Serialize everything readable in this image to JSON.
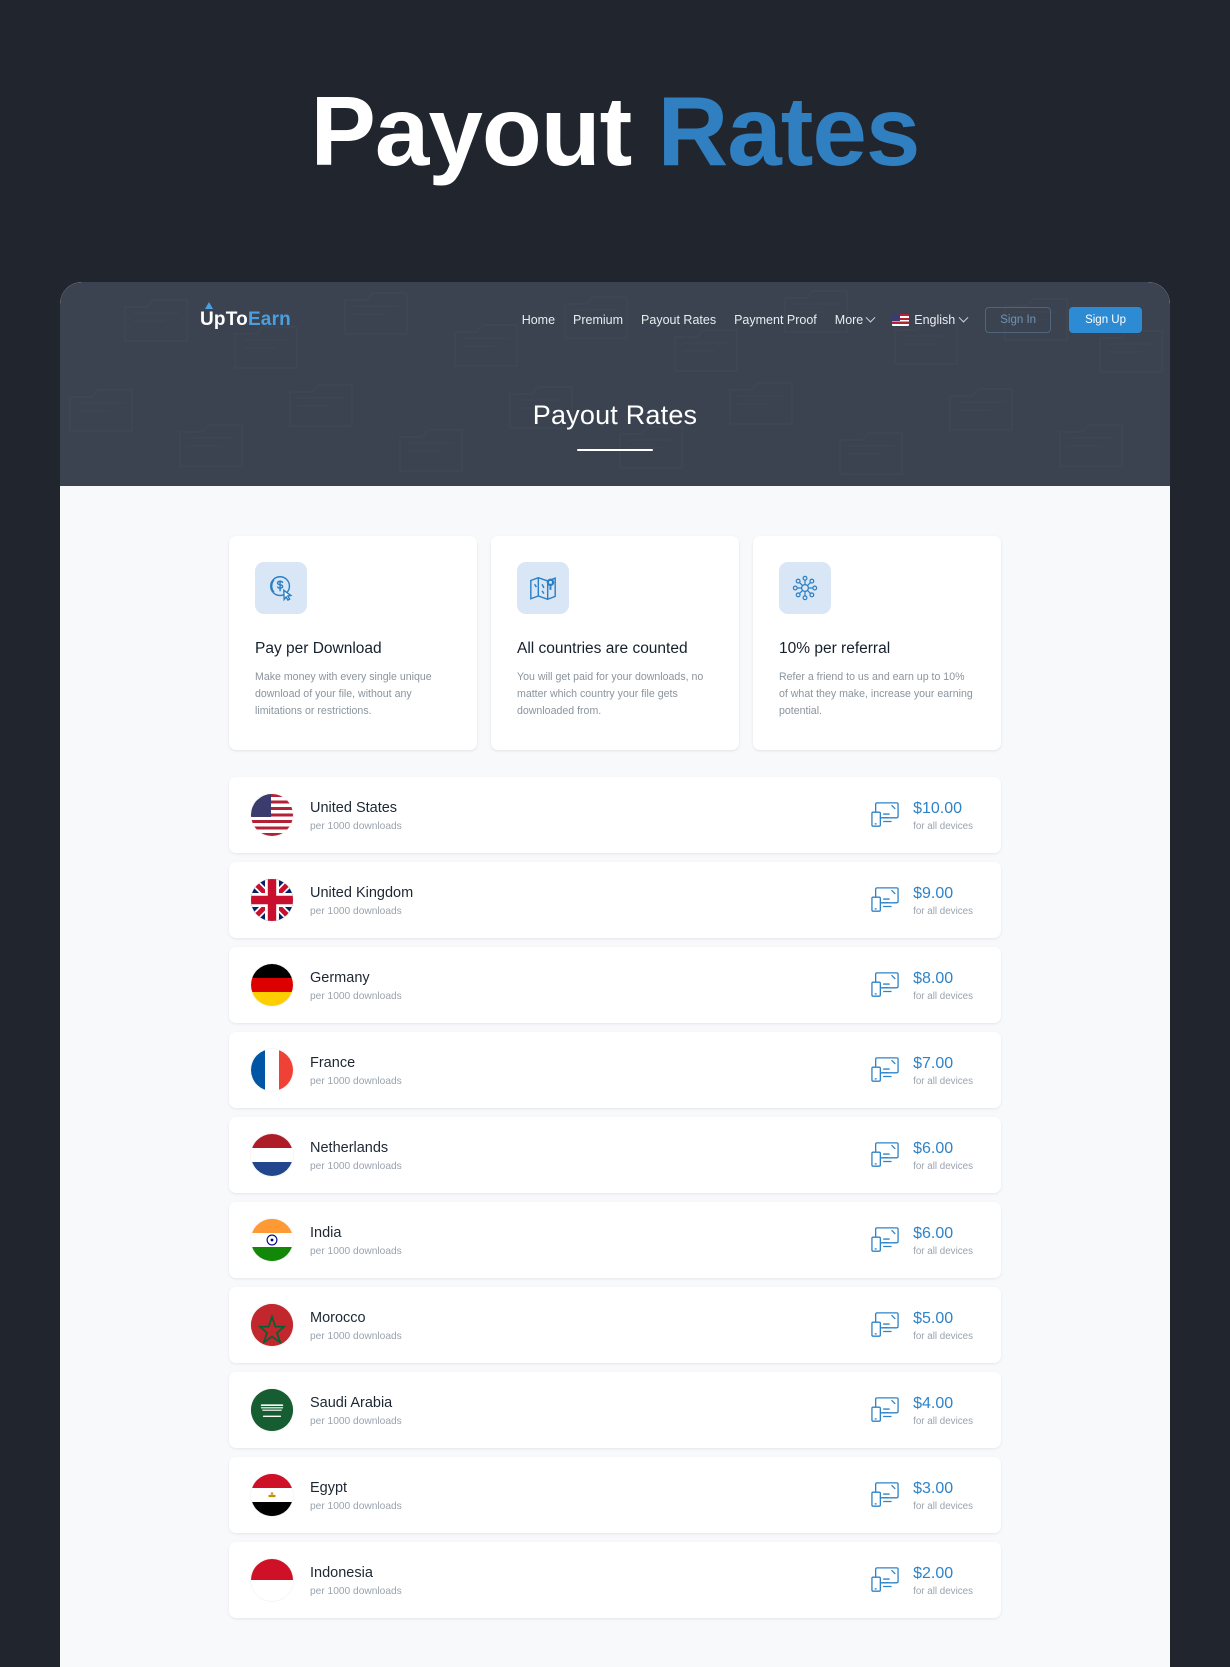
{
  "hero": {
    "word1": "Payout",
    "word2": "Rates"
  },
  "navbar": {
    "brand_up": "UpTo",
    "brand_earn": "Earn",
    "links": [
      {
        "label": "Home",
        "name": "nav-home"
      },
      {
        "label": "Premium",
        "name": "nav-premium"
      },
      {
        "label": "Payout Rates",
        "name": "nav-payout-rates"
      },
      {
        "label": "Payment Proof",
        "name": "nav-payment-proof"
      }
    ],
    "more_label": "More",
    "language": "English",
    "language_flag": "us-flag-icon",
    "sign_in": "Sign In",
    "sign_up": "Sign Up",
    "accent": "#2d8bd4"
  },
  "header": {
    "page_title": "Payout Rates"
  },
  "features": [
    {
      "icon": "coin-dollar-cursor-icon",
      "title": "Pay per Download",
      "desc": "Make money with every single unique download of your file, without any limitations or restrictions."
    },
    {
      "icon": "map-pin-icon",
      "title": "All countries are counted",
      "desc": "You will get paid for your downloads, no matter which country your file gets downloaded from."
    },
    {
      "icon": "network-nodes-icon",
      "title": "10% per referral",
      "desc": "Refer a friend to us and earn up to 10% of what they make, increase your earning potential."
    }
  ],
  "rates": {
    "sub_label": "per 1000 downloads",
    "devices_label": "for all devices",
    "device_icon": "devices-icon",
    "rows": [
      {
        "country": "United States",
        "flag": "f-us",
        "flag_name": "flag-united-states",
        "amount": "$10.00"
      },
      {
        "country": "United Kingdom",
        "flag": "f-uk",
        "flag_name": "flag-united-kingdom",
        "amount": "$9.00"
      },
      {
        "country": "Germany",
        "flag": "f-de",
        "flag_name": "flag-germany",
        "amount": "$8.00"
      },
      {
        "country": "France",
        "flag": "f-fr",
        "flag_name": "flag-france",
        "amount": "$7.00"
      },
      {
        "country": "Netherlands",
        "flag": "f-nl",
        "flag_name": "flag-netherlands",
        "amount": "$6.00"
      },
      {
        "country": "India",
        "flag": "f-in",
        "flag_name": "flag-india",
        "amount": "$6.00"
      },
      {
        "country": "Morocco",
        "flag": "f-ma",
        "flag_name": "flag-morocco",
        "amount": "$5.00"
      },
      {
        "country": "Saudi Arabia",
        "flag": "f-sa",
        "flag_name": "flag-saudi-arabia",
        "amount": "$4.00"
      },
      {
        "country": "Egypt",
        "flag": "f-eg",
        "flag_name": "flag-egypt",
        "amount": "$3.00"
      },
      {
        "country": "Indonesia",
        "flag": "f-id",
        "flag_name": "flag-indonesia",
        "amount": "$2.00"
      }
    ]
  }
}
